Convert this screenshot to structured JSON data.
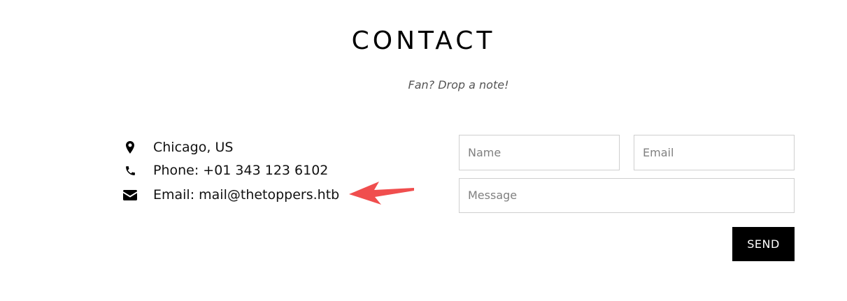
{
  "contact": {
    "title": "CONTACT",
    "subtitle": "Fan? Drop a note!"
  },
  "info": {
    "location": "Chicago, US",
    "phone": "Phone: +01 343 123 6102",
    "email": "Email: mail@thetoppers.htb"
  },
  "form": {
    "name_placeholder": "Name",
    "email_placeholder": "Email",
    "message_placeholder": "Message",
    "send_label": "SEND"
  },
  "annotation": {
    "arrow_color": "#f04e4e"
  }
}
